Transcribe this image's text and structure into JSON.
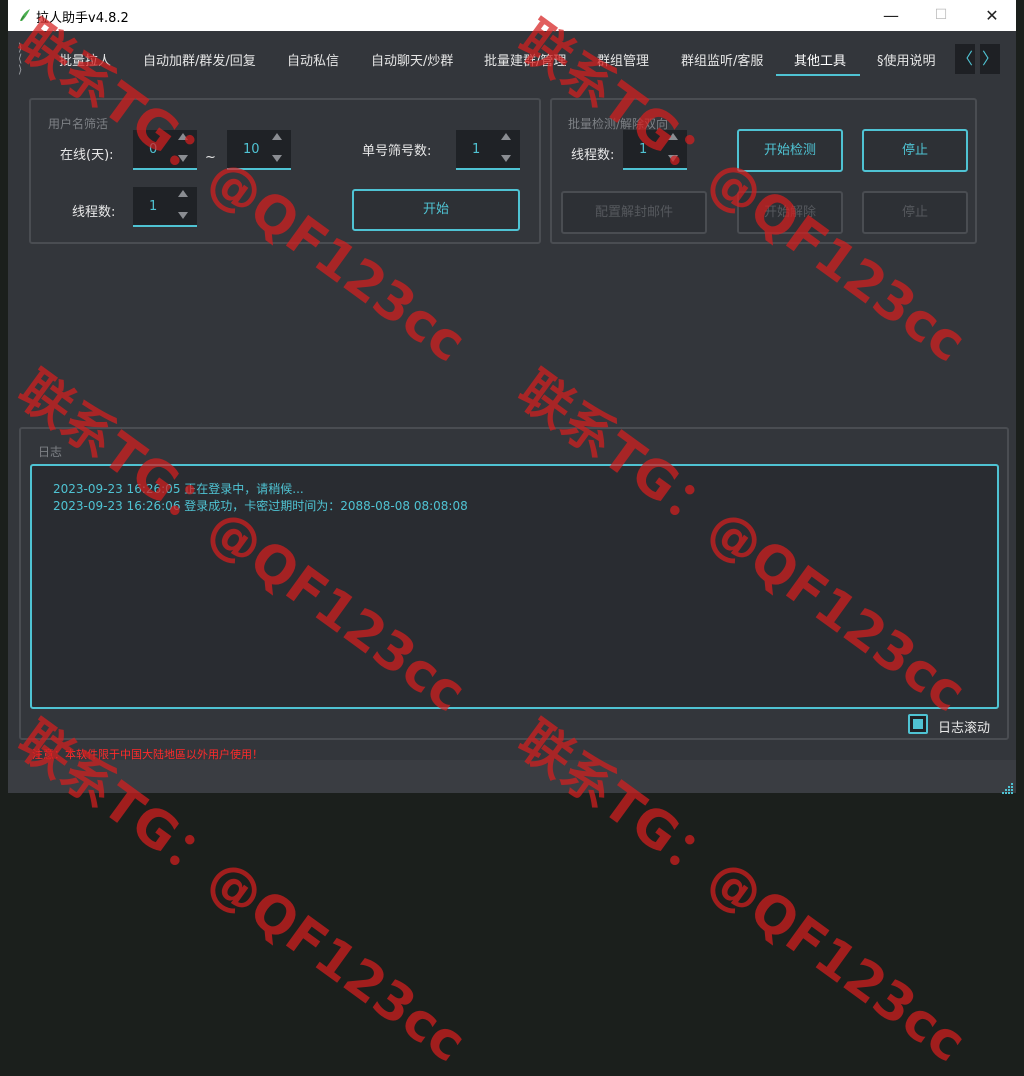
{
  "window": {
    "title": "拉人助手v4.8.2",
    "minimize": "—",
    "maximize": "☐",
    "close": "✕"
  },
  "tabs": [
    {
      "label": "批量拉人"
    },
    {
      "label": "自动加群/群发/回复"
    },
    {
      "label": "自动私信"
    },
    {
      "label": "自动聊天/炒群"
    },
    {
      "label": "批量建群/管理"
    },
    {
      "label": "群组管理"
    },
    {
      "label": "群组监听/客服"
    },
    {
      "label": "其他工具",
      "active": true
    },
    {
      "label": "§使用说明"
    }
  ],
  "nav": {
    "prev": "〈",
    "next": "〉",
    "side_glyph": "⟨⟩"
  },
  "username_filter": {
    "title": "用户名筛活",
    "online_label": "在线(天):",
    "online_from": "0",
    "tilde": "~",
    "online_to": "10",
    "single_filter_label": "单号筛号数:",
    "single_filter_value": "1",
    "threads_label": "线程数:",
    "threads_value": "1",
    "start_button": "开始"
  },
  "batch_check": {
    "title": "批量检测/解除双向",
    "threads_label": "线程数:",
    "threads_value": "1",
    "start_check_button": "开始检测",
    "stop_button": "停止",
    "config_unlock_button": "配置解封邮件",
    "start_unlock_button": "开始解除",
    "stop_unlock_button": "停止"
  },
  "log": {
    "title": "日志",
    "lines": [
      "2023-09-23 16:26:05 正在登录中，请稍候...",
      "2023-09-23 16:26:06 登录成功，卡密过期时间为：2088-08-08 08:08:08"
    ],
    "scroll_label": "日志滚动",
    "scroll_checked": true
  },
  "status": {
    "warning": "注意：本软件限于中国大陆地區以外用户使用！"
  },
  "watermark": {
    "text": "联系TG：@QF123cc"
  },
  "colors": {
    "accent": "#4fc3d3",
    "background": "#33363b",
    "warning": "#ff2a2a",
    "watermark": "#d61e1e"
  }
}
